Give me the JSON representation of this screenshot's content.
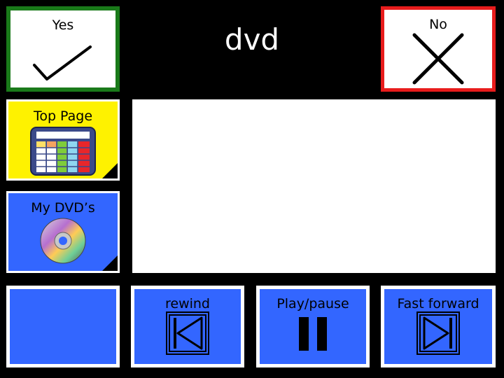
{
  "page_title": "dvd",
  "yes": {
    "label": "Yes",
    "icon": "checkmark-icon",
    "border_color": "#1a7a1a"
  },
  "no": {
    "label": "No",
    "icon": "x-icon",
    "border_color": "#e81c1c"
  },
  "sidebar": [
    {
      "label": "Top Page",
      "icon": "grid-board-icon",
      "bg": "#fef200"
    },
    {
      "label": "My DVD’s",
      "icon": "dvd-disc-icon",
      "bg": "#3366ff"
    }
  ],
  "controls": [
    {
      "label": "",
      "icon": ""
    },
    {
      "label": "rewind",
      "icon": "skip-back-icon"
    },
    {
      "label": "Play/pause",
      "icon": "pause-icon"
    },
    {
      "label": "Fast forward",
      "icon": "skip-forward-icon"
    }
  ],
  "colors": {
    "cell_blue": "#3366ff",
    "background": "#000000"
  }
}
